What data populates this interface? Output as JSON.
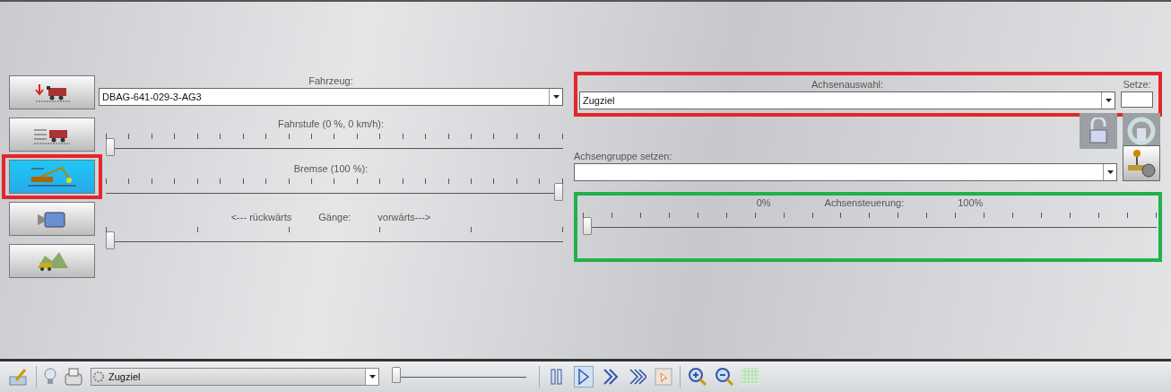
{
  "sidebar": {
    "items": [
      {
        "kind": "download-train",
        "selected": false
      },
      {
        "kind": "train-tracks",
        "selected": false
      },
      {
        "kind": "crane",
        "selected": true,
        "color": "#e3262b"
      },
      {
        "kind": "camera",
        "selected": false
      },
      {
        "kind": "landscape",
        "selected": false
      }
    ]
  },
  "vehicle": {
    "label": "Fahrzeug:",
    "value": "DBAG-641-029-3-AG3"
  },
  "speed": {
    "label": "Fahrstufe (0 %, 0 km/h):",
    "level": 0
  },
  "brake": {
    "label": "Bremse (100 %):",
    "level": 1
  },
  "gears": {
    "labels": [
      "<--- rückwärts",
      "Gänge:",
      "vorwärts--->"
    ],
    "level": 0
  },
  "axis_select": {
    "label": "Achsenauswahl:",
    "value": "Zugziel",
    "set_label": "Setze:",
    "color": "#e3262b"
  },
  "axis_group": {
    "label": "Achsengruppe setzen:"
  },
  "axis_control": {
    "labels": [
      "0%",
      "Achsensteuerung:",
      "100%"
    ],
    "level": 0,
    "color": "#22b04b"
  },
  "status_bar": {
    "combo_value": "Zugziel",
    "zoom_slider": {
      "level": 0
    },
    "play_modes": [
      {
        "kind": "pause",
        "selected": false
      },
      {
        "kind": "play",
        "selected": true
      },
      {
        "kind": "fast",
        "selected": false
      },
      {
        "kind": "faster",
        "selected": false
      }
    ]
  }
}
